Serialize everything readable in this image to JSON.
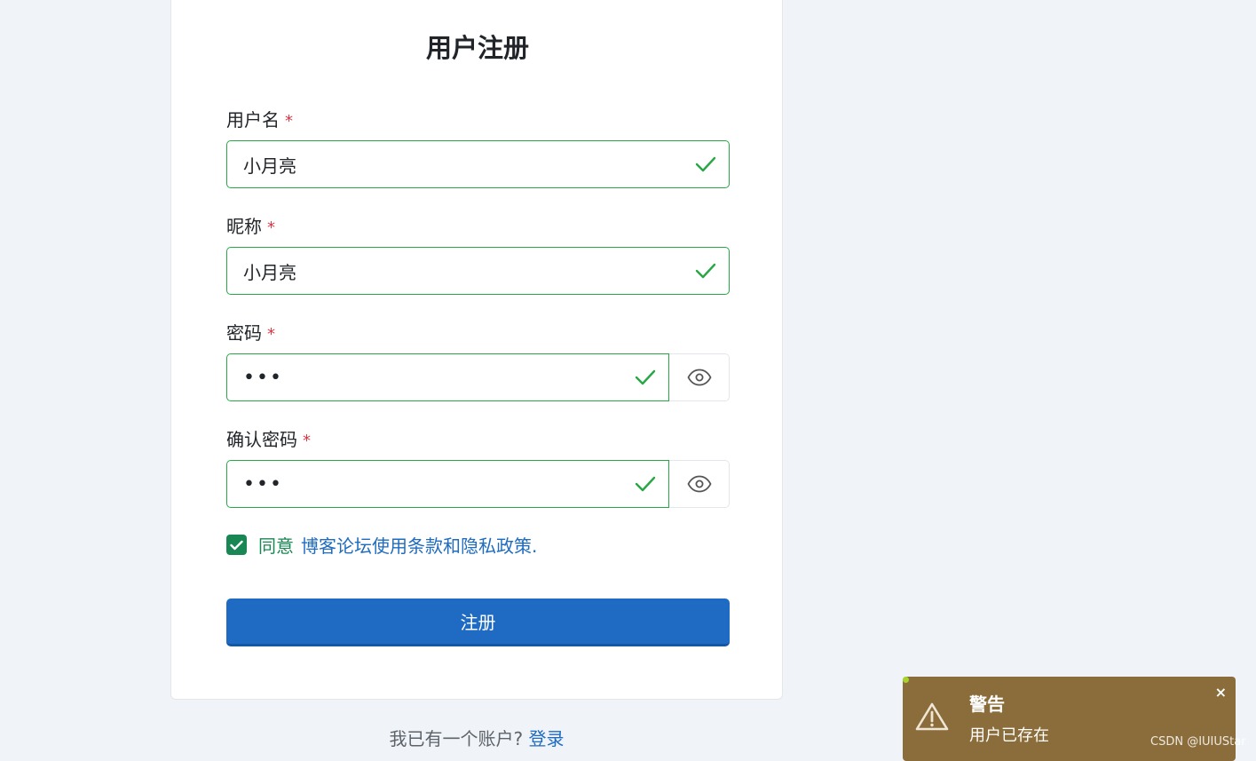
{
  "form": {
    "title": "用户注册",
    "username": {
      "label": "用户名",
      "required_mark": "*",
      "value": "小月亮"
    },
    "nickname": {
      "label": "昵称",
      "required_mark": "*",
      "value": "小月亮"
    },
    "password": {
      "label": "密码",
      "required_mark": "*",
      "value": "•••"
    },
    "confirm_password": {
      "label": "确认密码",
      "required_mark": "*",
      "value": "•••"
    },
    "agree": {
      "checked": true,
      "text": "同意",
      "terms_link": "博客论坛使用条款和隐私政策."
    },
    "submit_label": "注册"
  },
  "footer": {
    "text": "我已有一个账户?",
    "login_link": "登录"
  },
  "toast": {
    "title": "警告",
    "message": "用户已存在",
    "close": "×",
    "icon": "warning-triangle-icon",
    "bg_color": "#8b6d3b"
  },
  "watermark": "CSDN @IUIUStar",
  "colors": {
    "valid": "#28a745",
    "primary": "#1f6bc3",
    "required": "#dc3545",
    "link": "#1f6bbf"
  }
}
